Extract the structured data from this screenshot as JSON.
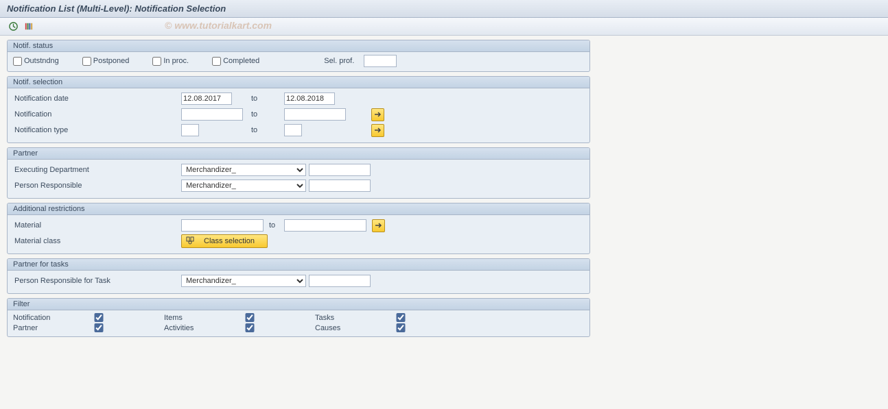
{
  "title": "Notification List (Multi-Level): Notification Selection",
  "watermark": "© www.tutorialkart.com",
  "groups": {
    "status": {
      "header": "Notif. status",
      "outstanding": "Outstndng",
      "postponed": "Postponed",
      "in_proc": "In proc.",
      "completed": "Completed",
      "sel_prof": "Sel. prof."
    },
    "selection": {
      "header": "Notif. selection",
      "date_label": "Notification date",
      "date_from": "12.08.2017",
      "date_to": "12.08.2018",
      "to": "to",
      "notif_label": "Notification",
      "type_label": "Notification type"
    },
    "partner": {
      "header": "Partner",
      "exec_dept": "Executing Department",
      "exec_val": "Merchandizer_",
      "person": "Person Responsible",
      "person_val": "Merchandizer_"
    },
    "additional": {
      "header": "Additional restrictions",
      "material": "Material",
      "to": "to",
      "material_class": "Material class",
      "class_btn": "Class selection"
    },
    "tasks": {
      "header": "Partner for tasks",
      "person": "Person Responsible for Task",
      "person_val": "Merchandizer_"
    },
    "filter": {
      "header": "Filter",
      "notification": "Notification",
      "items": "Items",
      "tasks_lbl": "Tasks",
      "partner": "Partner",
      "activities": "Activities",
      "causes": "Causes"
    }
  }
}
